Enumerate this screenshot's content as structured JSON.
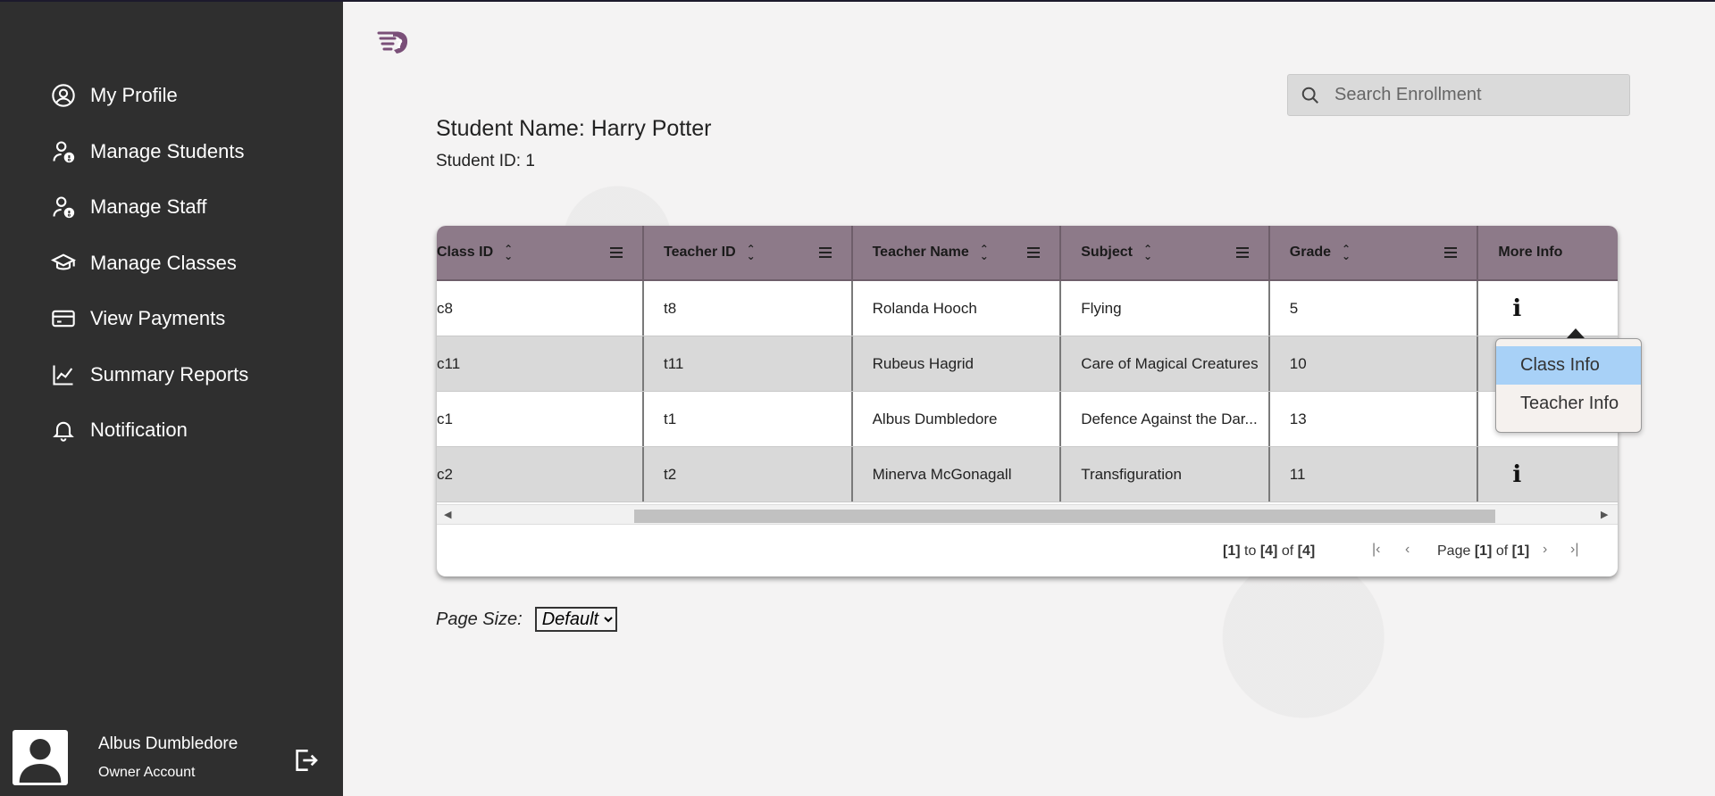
{
  "sidebar": {
    "items": [
      {
        "label": "My Profile",
        "icon": "user-circle-icon"
      },
      {
        "label": "Manage Students",
        "icon": "user-alert-icon"
      },
      {
        "label": "Manage Staff",
        "icon": "user-alert-icon"
      },
      {
        "label": "Manage Classes",
        "icon": "graduation-cap-icon"
      },
      {
        "label": "View Payments",
        "icon": "credit-card-icon"
      },
      {
        "label": "Summary Reports",
        "icon": "line-chart-icon"
      },
      {
        "label": "Notification",
        "icon": "bell-icon"
      }
    ],
    "user": {
      "name": "Albus Dumbledore",
      "role": "Owner Account"
    }
  },
  "search": {
    "placeholder": "Search Enrollment"
  },
  "student": {
    "name": "Student Name: Harry Potter",
    "id": "Student ID: 1"
  },
  "grid": {
    "columns": [
      "Class ID",
      "Teacher ID",
      "Teacher Name",
      "Subject",
      "Grade",
      "More Info"
    ],
    "rows": [
      {
        "class_id": "c8",
        "teacher_id": "t8",
        "teacher_name": "Rolanda Hooch",
        "subject": "Flying",
        "grade": "5",
        "info": "i"
      },
      {
        "class_id": "c11",
        "teacher_id": "t11",
        "teacher_name": "Rubeus Hagrid",
        "subject": "Care of Magical Creatures",
        "grade": "10",
        "info": ""
      },
      {
        "class_id": "c1",
        "teacher_id": "t1",
        "teacher_name": "Albus Dumbledore",
        "subject": "Defence Against the Dar...",
        "grade": "13",
        "info": ""
      },
      {
        "class_id": "c2",
        "teacher_id": "t2",
        "teacher_name": "Minerva McGonagall",
        "subject": "Transfiguration",
        "grade": "11",
        "info": "i"
      }
    ],
    "paging": {
      "from": "[1]",
      "to_word": "to",
      "to": "[4]",
      "of_word": "of",
      "total": "[4]",
      "page_word": "Page",
      "page": "[1]",
      "pages": "[1]"
    }
  },
  "more_info_menu": {
    "items": [
      "Class Info",
      "Teacher Info"
    ]
  },
  "page_size": {
    "label": "Page Size:",
    "selected": "Default"
  },
  "colors": {
    "sidebar": "#2f2f2f",
    "header": "#8d7a89",
    "menu_highlight": "#a8d1f7"
  }
}
